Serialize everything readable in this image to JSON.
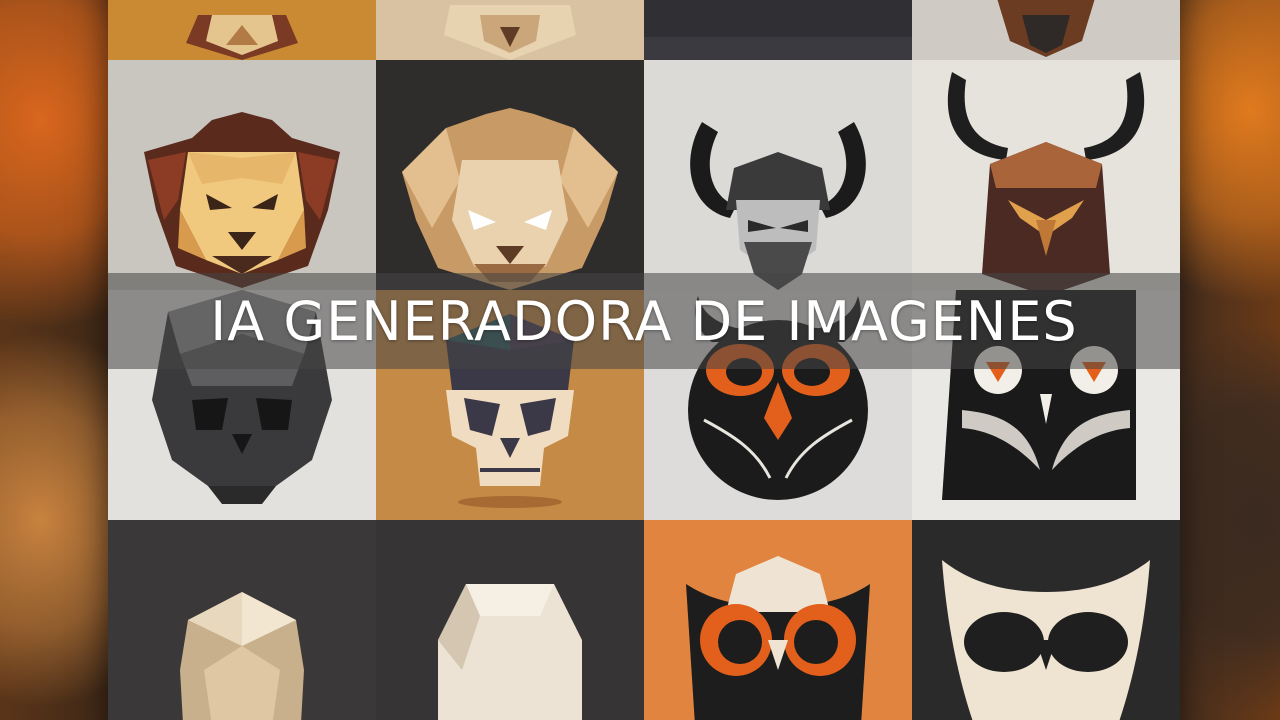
{
  "title": "IA GENERADORA DE IMAGENES",
  "palette": {
    "orange": "#e0661e",
    "tan": "#e2c08e",
    "brown": "#5a2b1c",
    "dark": "#1e1e1f",
    "light": "#e6e3df"
  },
  "tiles": [
    {
      "subject": "lion-head",
      "bg": "#c98a33"
    },
    {
      "subject": "lion-head",
      "bg": "#d8c2a2"
    },
    {
      "subject": "helmet",
      "bg": "#2f2f34"
    },
    {
      "subject": "horned-helmet",
      "bg": "#cfcac4"
    },
    {
      "subject": "lion-head",
      "bg": "#c9c5bf"
    },
    {
      "subject": "lion-head",
      "bg": "#2f2c2c"
    },
    {
      "subject": "horned-bearded-face",
      "bg": "#dcdad7"
    },
    {
      "subject": "horned-helmet",
      "bg": "#e6e2dc"
    },
    {
      "subject": "skull",
      "bg": "#e3e1de"
    },
    {
      "subject": "skull",
      "bg": "#c58a45"
    },
    {
      "subject": "owl",
      "bg": "#dedcda"
    },
    {
      "subject": "owl",
      "bg": "#eae8e5"
    },
    {
      "subject": "skull",
      "bg": "#3a3838"
    },
    {
      "subject": "skull",
      "bg": "#363434"
    },
    {
      "subject": "owl",
      "bg": "#e08440"
    },
    {
      "subject": "owl",
      "bg": "#2b2a2a"
    }
  ]
}
